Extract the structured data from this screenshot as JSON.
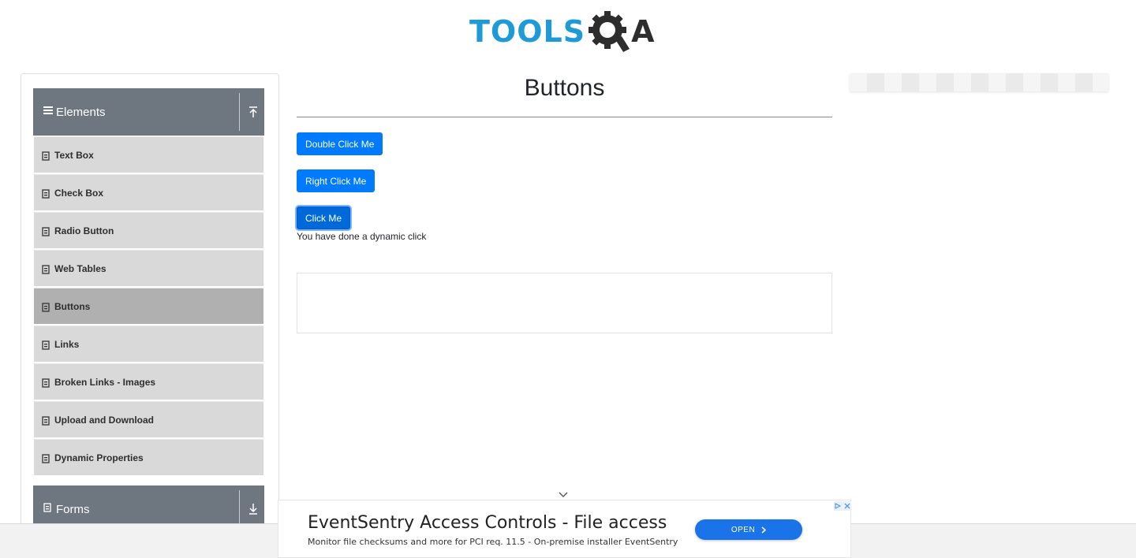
{
  "header": {
    "logo_text": "TOOLS",
    "logo_suffix": "A"
  },
  "sidebar": {
    "group_elements": {
      "label": "Elements"
    },
    "items": [
      {
        "label": "Text Box",
        "active": false
      },
      {
        "label": "Check Box",
        "active": false
      },
      {
        "label": "Radio Button",
        "active": false
      },
      {
        "label": "Web Tables",
        "active": false
      },
      {
        "label": "Buttons",
        "active": true
      },
      {
        "label": "Links",
        "active": false
      },
      {
        "label": "Broken Links - Images",
        "active": false
      },
      {
        "label": "Upload and Download",
        "active": false
      },
      {
        "label": "Dynamic Properties",
        "active": false
      }
    ],
    "group_forms": {
      "label": "Forms"
    }
  },
  "main": {
    "title": "Buttons",
    "double_click_label": "Double Click Me",
    "right_click_label": "Right Click Me",
    "click_label": "Click Me",
    "result_message": "You have done a dynamic click"
  },
  "ad": {
    "title": "EventSentry Access Controls - File access",
    "subtitle": "Monitor file checksums and more for PCI req. 11.5 - On-premise installer EventSentry",
    "open_label": "OPEN"
  },
  "colors": {
    "primary": "#007bff",
    "sidebar_header": "#6e7680",
    "menu_item": "#d9d9d9",
    "menu_item_active": "#b0b0b0",
    "logo_blue": "#1e9bd7"
  }
}
